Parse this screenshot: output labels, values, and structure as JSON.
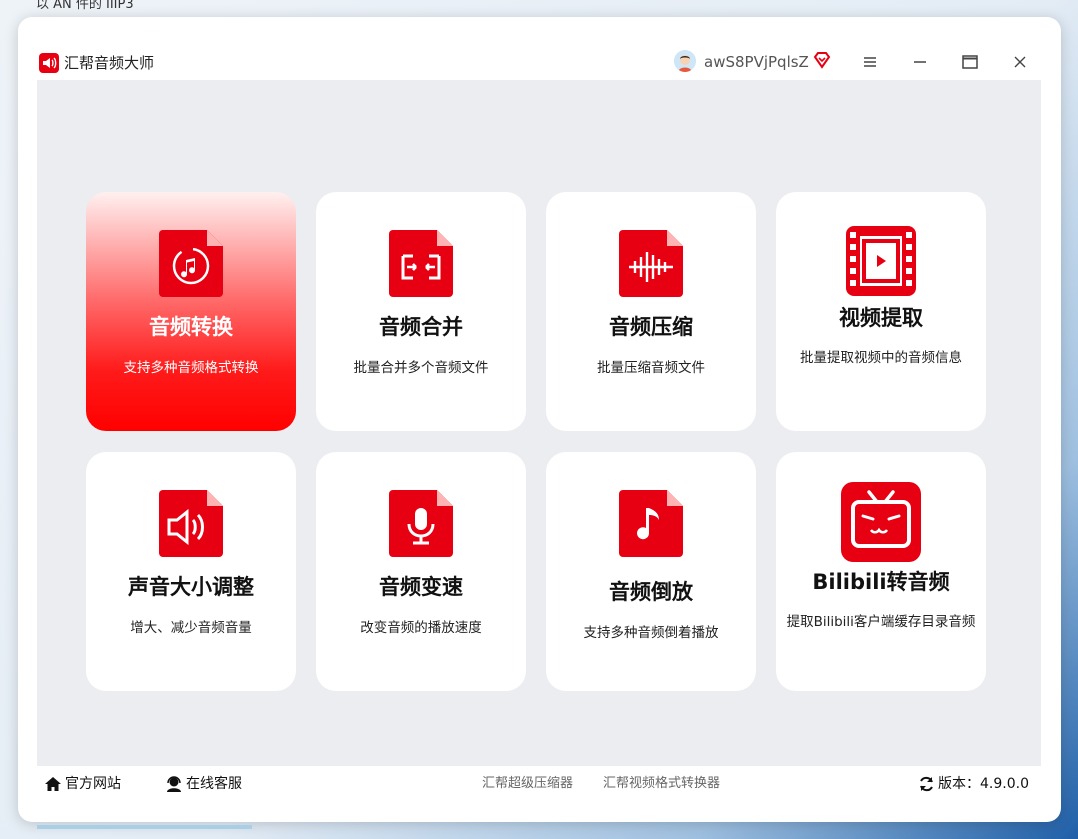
{
  "desktop": {
    "partial_text": "以 AN 件的 IIIP3"
  },
  "window": {
    "app_title": "汇帮音频大师",
    "username": "awS8PVjPqlsZ",
    "accent_color": "#e60012"
  },
  "cards": [
    {
      "title": "音频转换",
      "desc": "支持多种音频格式转换",
      "icon": "convert-icon",
      "active": true
    },
    {
      "title": "音频合并",
      "desc": "批量合并多个音频文件",
      "icon": "merge-icon",
      "active": false
    },
    {
      "title": "音频压缩",
      "desc": "批量压缩音频文件",
      "icon": "compress-icon",
      "active": false
    },
    {
      "title": "视频提取",
      "desc": "批量提取视频中的音频信息",
      "icon": "video-extract-icon",
      "active": false
    },
    {
      "title": "声音大小调整",
      "desc": "增大、减少音频音量",
      "icon": "volume-icon",
      "active": false
    },
    {
      "title": "音频变速",
      "desc": "改变音频的播放速度",
      "icon": "microphone-icon",
      "active": false
    },
    {
      "title": "音频倒放",
      "desc": "支持多种音频倒着播放",
      "icon": "music-note-icon",
      "active": false
    },
    {
      "title": "Bilibili转音频",
      "desc": "提取Bilibili客户端缓存目录音频",
      "icon": "bilibili-icon",
      "active": false
    }
  ],
  "footer": {
    "website": "官方网站",
    "support": "在线客服",
    "link1": "汇帮超级压缩器",
    "link2": "汇帮视频格式转换器",
    "version_label": "版本：",
    "version": "4.9.0.0"
  }
}
